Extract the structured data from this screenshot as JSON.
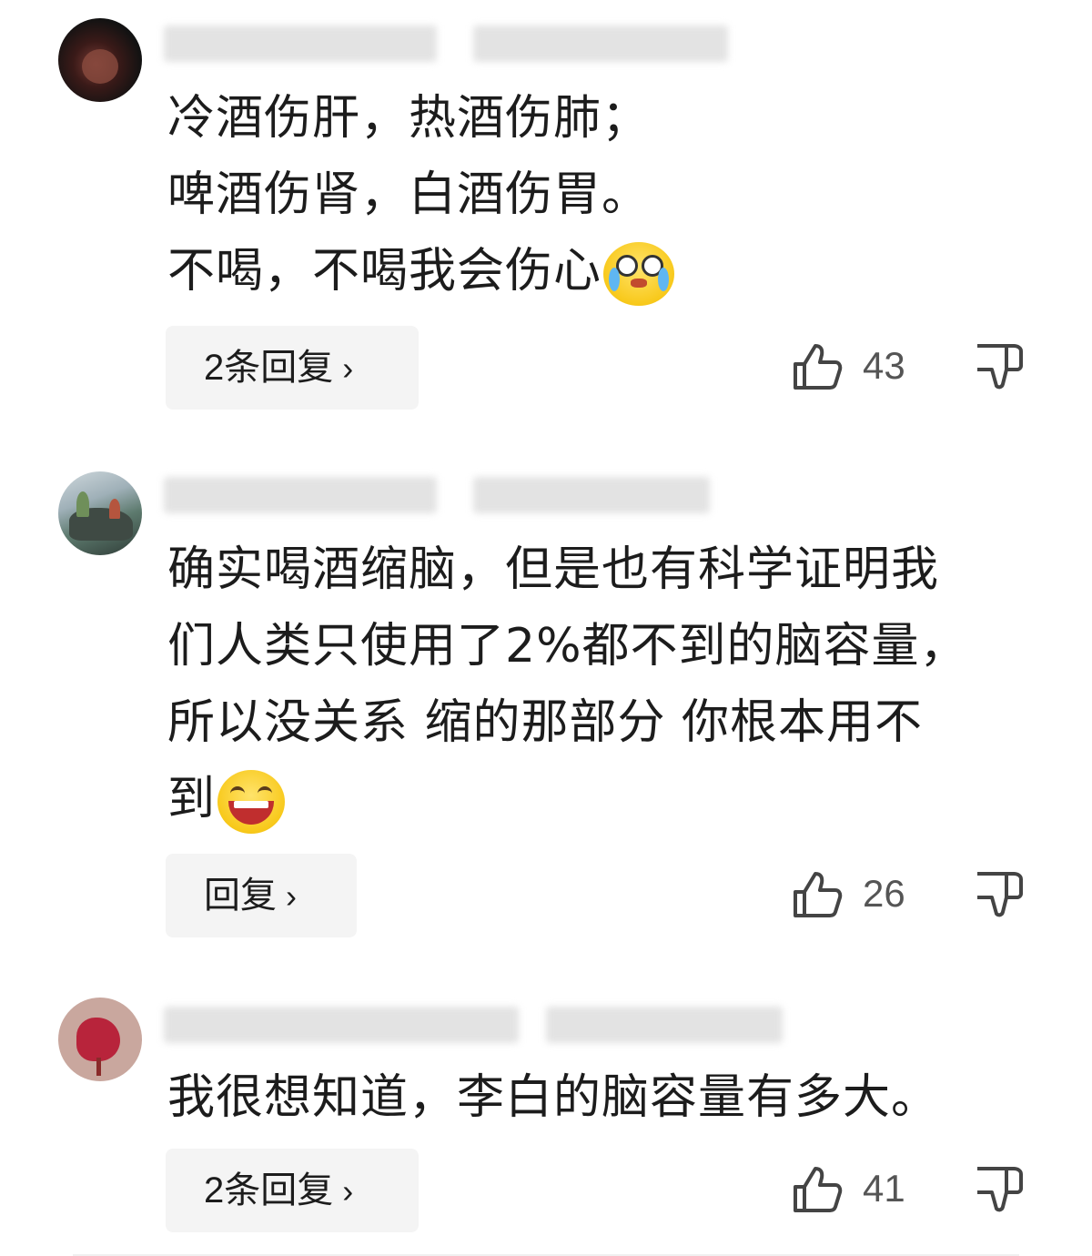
{
  "comments": [
    {
      "lines": [
        "冷酒伤肝，热酒伤肺；",
        "啤酒伤肾，白酒伤胃。",
        "不喝，不喝我会伤心"
      ],
      "emoji": "crying-face-emoji",
      "reply_label": "2条回复",
      "like_count": "43"
    },
    {
      "lines": [
        "确实喝酒缩脑，但是也有科学证明我",
        "们人类只使用了2%都不到的脑容量，",
        "所以没关系 缩的那部分 你根本用不",
        "到"
      ],
      "emoji": "laughing-face-emoji",
      "reply_label": "回复",
      "like_count": "26"
    },
    {
      "lines": [
        "我很想知道，李白的脑容量有多大。"
      ],
      "reply_label": "2条回复",
      "like_count": "41"
    }
  ],
  "icons": {
    "like": "thumbs-up-icon",
    "dislike": "thumbs-down-icon",
    "chevron": "chevron-right-icon"
  },
  "chevron_glyph": "›"
}
